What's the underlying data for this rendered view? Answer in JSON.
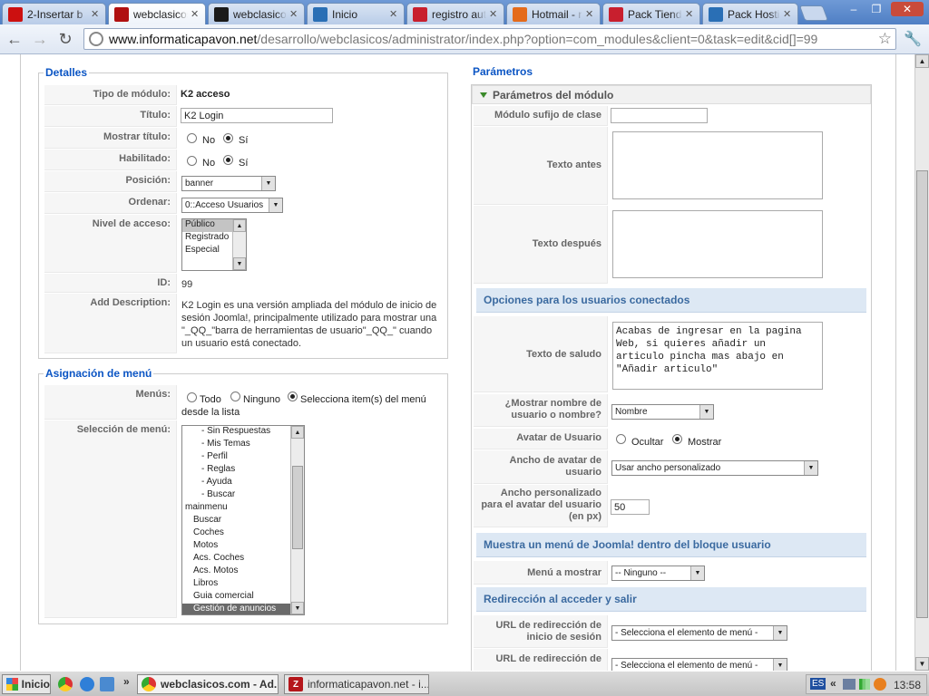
{
  "browser": {
    "tabs": [
      {
        "label": "2-Insertar b",
        "favicon": "youtube-icon",
        "color": "#cc1010",
        "active": false
      },
      {
        "label": "webclasicos.",
        "favicon": "webclasicos-icon",
        "color": "#b01010",
        "active": true
      },
      {
        "label": "webclasicos.",
        "favicon": "joomla-icon",
        "color": "#1b1b1b",
        "active": false
      },
      {
        "label": "Inicio",
        "favicon": "joomla-icon",
        "color": "#2a6fb5",
        "active": false
      },
      {
        "label": "registro auto",
        "favicon": "webclasicos-icon",
        "color": "#c81f2e",
        "active": false
      },
      {
        "label": "Hotmail - rafa",
        "favicon": "hotmail-icon",
        "color": "#e46b1c",
        "active": false
      },
      {
        "label": "Pack Tienda",
        "favicon": "webclasicos-icon",
        "color": "#c81f2e",
        "active": false
      },
      {
        "label": "Pack Hosting",
        "favicon": "joomla-icon",
        "color": "#2a6fb5",
        "active": false
      }
    ],
    "url_host": "www.informaticapavon.net",
    "url_rest": "/desarrollo/webclasicos/administrator/index.php?option=com_modules&client=0&task=edit&cid[]=99"
  },
  "detalles": {
    "legend": "Detalles",
    "tipo_label": "Tipo de módulo:",
    "tipo_value": "K2 acceso",
    "titulo_label": "Título:",
    "titulo_value": "K2 Login",
    "mostrar_label": "Mostrar título:",
    "habilitado_label": "Habilitado:",
    "no": "No",
    "si": "Sí",
    "posicion_label": "Posición:",
    "posicion_value": "banner",
    "ordenar_label": "Ordenar:",
    "ordenar_value": "0::Acceso Usuarios",
    "nivel_label": "Nivel de acceso:",
    "nivel_options": [
      "Público",
      "Registrado",
      "Especial"
    ],
    "id_label": "ID:",
    "id_value": "99",
    "desc_label": "Add Description:",
    "desc_lines": [
      "K2 Login es una versión ampliada del módulo de inicio de",
      "sesión Joomla!, principalmente utilizado para mostrar una",
      "\"_QQ_\"barra de herramientas de usuario\"_QQ_\" cuando",
      "un usuario está conectado."
    ]
  },
  "asignacion": {
    "legend": "Asignación de menú",
    "menus_label": "Menús:",
    "todo": "Todo",
    "ninguno": "Ninguno",
    "selecciona_1": "Selecciona item(s) del menú",
    "selecciona_2": "desde la lista",
    "seleccion_label": "Selección de menú:",
    "menu_items": [
      {
        "text": "- Sin Respuestas",
        "indent": 2
      },
      {
        "text": "- Mis Temas",
        "indent": 2
      },
      {
        "text": "- Perfil",
        "indent": 2
      },
      {
        "text": "- Reglas",
        "indent": 2
      },
      {
        "text": "- Ayuda",
        "indent": 2
      },
      {
        "text": "- Buscar",
        "indent": 2
      },
      {
        "text": "mainmenu",
        "indent": 0
      },
      {
        "text": "Buscar",
        "indent": 1
      },
      {
        "text": "Coches",
        "indent": 1
      },
      {
        "text": "Motos",
        "indent": 1
      },
      {
        "text": "Acs. Coches",
        "indent": 1
      },
      {
        "text": "Acs. Motos",
        "indent": 1
      },
      {
        "text": "Libros",
        "indent": 1
      },
      {
        "text": "Guia comercial",
        "indent": 1
      },
      {
        "text": "Gestión de anuncios",
        "indent": 1
      }
    ]
  },
  "parametros": {
    "legend": "Parámetros",
    "modulo_head": "Parámetros del módulo",
    "sufijo_label": "Módulo sufijo de clase",
    "texto_antes_label": "Texto antes",
    "texto_despues_label": "Texto después",
    "opciones_head": "Opciones para los usuarios conectados",
    "saludo_label": "Texto de saludo",
    "saludo_value": "Acabas de ingresar en la pagina Web, si quieres añadir un articulo pincha mas abajo en \"Añadir articulo\"",
    "mostrar_nombre_label_1": "¿Mostrar nombre de",
    "mostrar_nombre_label_2": "usuario o nombre?",
    "mostrar_nombre_value": "Nombre",
    "avatar_label": "Avatar de Usuario",
    "ocultar": "Ocultar",
    "mostrar": "Mostrar",
    "ancho_label_1": "Ancho de avatar de",
    "ancho_label_2": "usuario",
    "ancho_value": "Usar ancho personalizado",
    "ancho_pers_label_1": "Ancho personalizado",
    "ancho_pers_label_2": "para el avatar del usuario",
    "ancho_pers_label_3": "(en px)",
    "ancho_pers_value": "50",
    "menu_head": "Muestra un menú de Joomla! dentro del bloque usuario",
    "menu_mostrar_label": "Menú a mostrar",
    "menu_mostrar_value": "-- Ninguno --",
    "redir_head": "Redirección al acceder y salir",
    "url_inicio_label_1": "URL de redirección de",
    "url_inicio_label_2": "inicio de sesión",
    "url_inicio_value": "- Selecciona el elemento de menú -",
    "url_cierre_label_1": "URL de redirección de",
    "url_cierre_value": "- Selecciona el elemento de menú -"
  },
  "taskbar": {
    "start": "Inicio",
    "task1": "webclasicos.com - Ad...",
    "task2": "informaticapavon.net - i...",
    "lang": "ES",
    "clock": "13:58"
  }
}
